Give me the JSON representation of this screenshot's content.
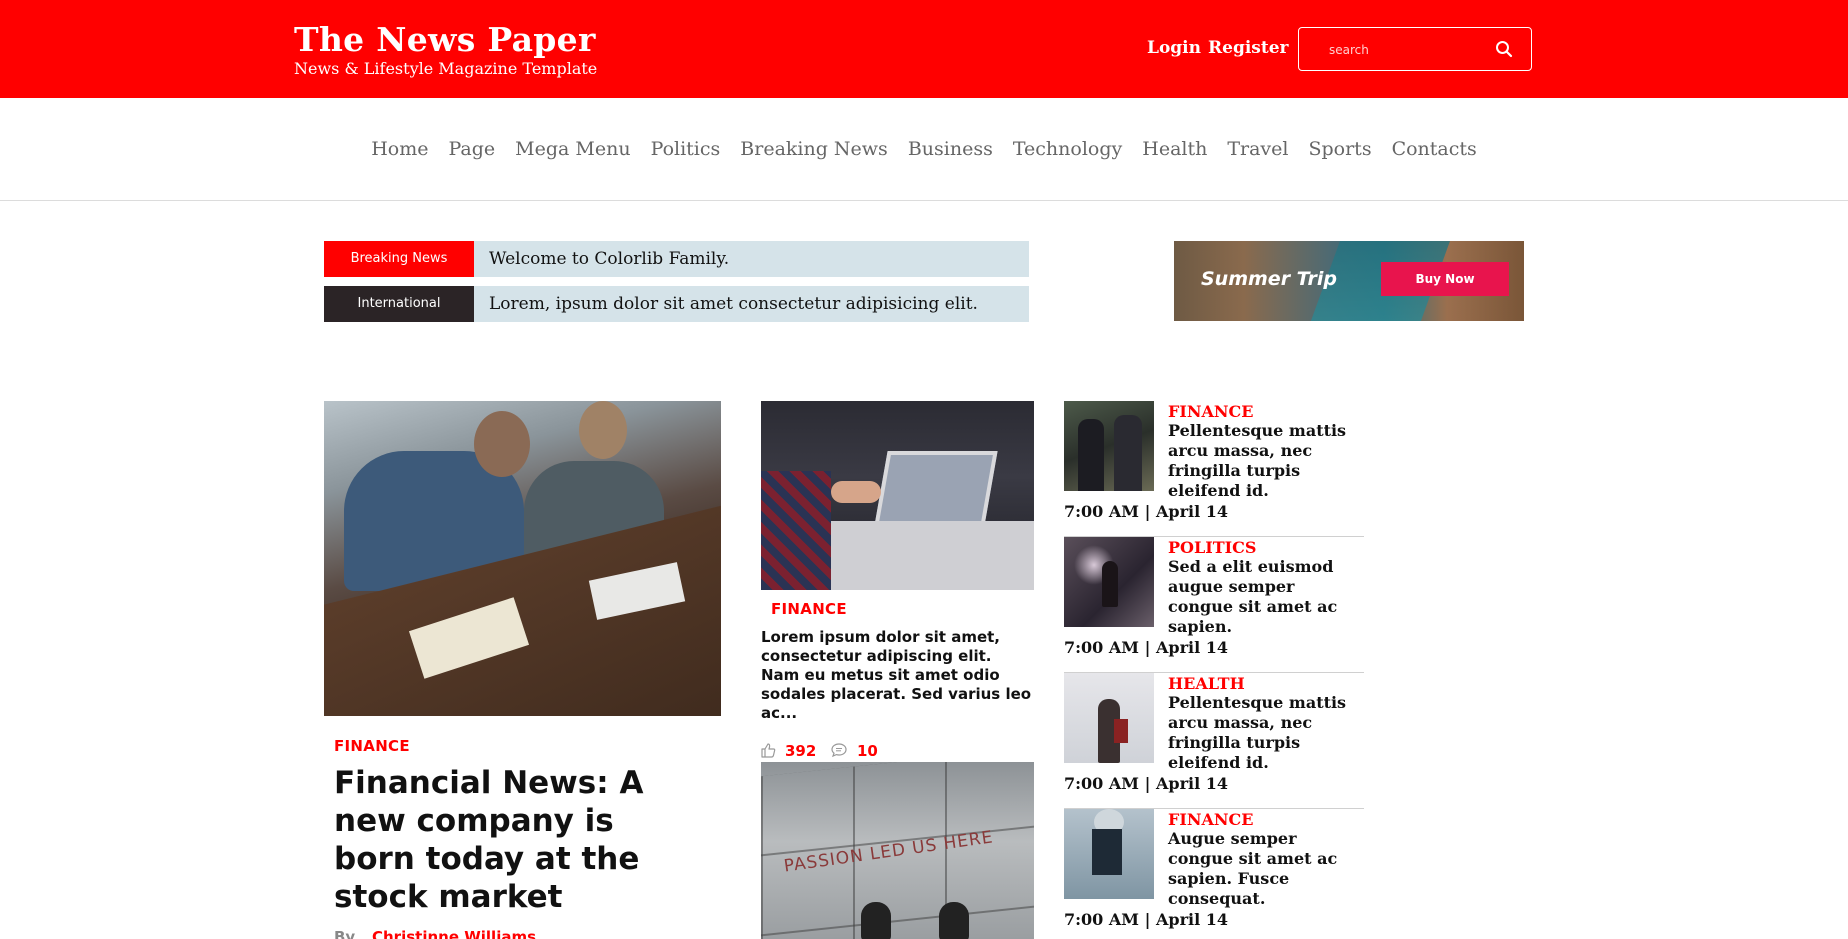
{
  "header": {
    "brand_title": "The News Paper",
    "brand_subtitle": "News & Lifestyle Magazine Template",
    "login_label": "Login",
    "register_label": "Register",
    "search_placeholder": "search",
    "accent_color": "#ff0000"
  },
  "nav": {
    "items": [
      "Home",
      "Page",
      "Mega Menu",
      "Politics",
      "Breaking News",
      "Business",
      "Technology",
      "Health",
      "Travel",
      "Sports",
      "Contacts"
    ]
  },
  "tickers": [
    {
      "tag": "Breaking News",
      "tag_color": "#ff0000",
      "text": "Welcome to Colorlib Family."
    },
    {
      "tag": "International",
      "tag_color": "#2b2426",
      "text": "Lorem, ipsum dolor sit amet consectetur adipisicing elit."
    }
  ],
  "ad": {
    "title": "Summer Trip",
    "button": "Buy Now"
  },
  "featured": {
    "category": "FINANCE",
    "title": "Financial News: A new company is born today at the stock market",
    "by_label": "By",
    "author": "Christinne Williams"
  },
  "middle": {
    "category": "FINANCE",
    "title": "Lorem ipsum dolor sit amet, consectetur adipiscing elit. Nam eu metus sit amet odio sodales placerat. Sed varius leo ac...",
    "likes": "392",
    "comments": "10",
    "second_image_text": "PASSION LED US HERE"
  },
  "sidebar": {
    "items": [
      {
        "category": "FINANCE",
        "title": "Pellentesque mattis arcu massa, nec fringilla turpis eleifend id.",
        "time": "7:00 AM | April 14"
      },
      {
        "category": "POLITICS",
        "title": "Sed a elit euismod augue semper congue sit amet ac sapien.",
        "time": "7:00 AM | April 14"
      },
      {
        "category": "HEALTH",
        "title": "Pellentesque mattis arcu massa, nec fringilla turpis eleifend id.",
        "time": "7:00 AM | April 14"
      },
      {
        "category": "FINANCE",
        "title": "Augue semper congue sit amet ac sapien. Fusce consequat.",
        "time": "7:00 AM | April 14"
      }
    ]
  }
}
